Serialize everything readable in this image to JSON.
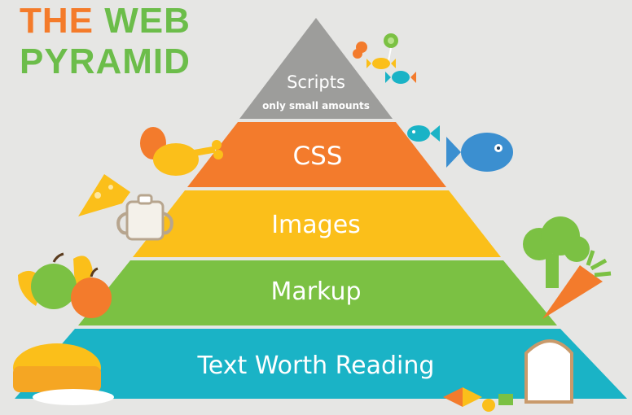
{
  "title": {
    "word1": "THE",
    "word2": "WEB",
    "line2": "PYRAMID"
  },
  "tiers": [
    {
      "label": "Scripts",
      "sublabel": "only small amounts",
      "color": "#9d9d9b"
    },
    {
      "label": "CSS",
      "color": "#f37b2c"
    },
    {
      "label": "Images",
      "color": "#fbbf1a"
    },
    {
      "label": "Markup",
      "color": "#7bc143"
    },
    {
      "label": "Text Worth Reading",
      "color": "#1ab3c6"
    }
  ],
  "decorations": {
    "candy": "candy-icon",
    "chicken": "chicken-leg-icon",
    "cheese": "cheese-icon",
    "milk": "milk-cup-icon",
    "fruit": "fruit-icon",
    "bread": "bread-icon",
    "fish": "fish-icon",
    "broccoli": "broccoli-icon",
    "carrot": "carrot-icon",
    "toast": "toast-icon",
    "pasta": "pasta-icon"
  }
}
